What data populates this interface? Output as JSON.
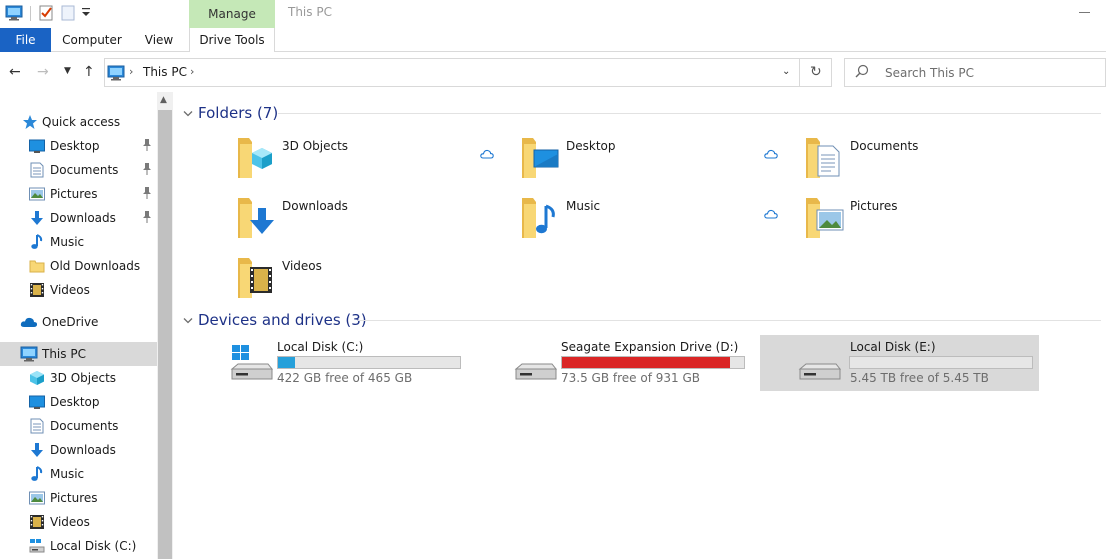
{
  "window": {
    "title": "This PC"
  },
  "ribbon": {
    "contextual_group": "Manage",
    "tabs": [
      {
        "label": "File"
      },
      {
        "label": "Computer"
      },
      {
        "label": "View"
      },
      {
        "label": "Drive Tools"
      }
    ]
  },
  "address": {
    "path": [
      "This PC"
    ],
    "search_placeholder": "Search This PC"
  },
  "sidebar": {
    "items": [
      {
        "label": "Quick access",
        "icon": "star-icon"
      },
      {
        "label": "Desktop",
        "icon": "desktop-icon",
        "pinned": true
      },
      {
        "label": "Documents",
        "icon": "documents-icon",
        "pinned": true
      },
      {
        "label": "Pictures",
        "icon": "pictures-icon",
        "pinned": true
      },
      {
        "label": "Downloads",
        "icon": "downloads-icon",
        "pinned": true
      },
      {
        "label": "Music",
        "icon": "music-icon"
      },
      {
        "label": "Old Downloads",
        "icon": "folder-icon"
      },
      {
        "label": "Videos",
        "icon": "videos-icon"
      },
      {
        "label": "OneDrive",
        "icon": "onedrive-cloud-icon"
      },
      {
        "label": "This PC",
        "icon": "computer-icon",
        "selected": true
      },
      {
        "label": "3D Objects",
        "icon": "3d-objects-icon"
      },
      {
        "label": "Desktop",
        "icon": "desktop-icon"
      },
      {
        "label": "Documents",
        "icon": "documents-icon"
      },
      {
        "label": "Downloads",
        "icon": "downloads-icon"
      },
      {
        "label": "Music",
        "icon": "music-icon"
      },
      {
        "label": "Pictures",
        "icon": "pictures-icon"
      },
      {
        "label": "Videos",
        "icon": "videos-icon"
      },
      {
        "label": "Local Disk (C:)",
        "icon": "windows-drive-icon"
      }
    ]
  },
  "folders": {
    "header": "Folders (7)",
    "items": [
      {
        "label": "3D Objects",
        "icon": "3d-objects-folder-icon",
        "cloud": true
      },
      {
        "label": "Desktop",
        "icon": "desktop-folder-icon",
        "cloud": true
      },
      {
        "label": "Documents",
        "icon": "documents-folder-icon",
        "cloud": false
      },
      {
        "label": "Downloads",
        "icon": "downloads-folder-icon",
        "cloud": false
      },
      {
        "label": "Music",
        "icon": "music-folder-icon",
        "cloud": true
      },
      {
        "label": "Pictures",
        "icon": "pictures-folder-icon",
        "cloud": false
      },
      {
        "label": "Videos",
        "icon": "videos-folder-icon",
        "cloud": false
      }
    ]
  },
  "drives": {
    "header": "Devices and drives (3)",
    "items": [
      {
        "label": "Local Disk (C:)",
        "free_text": "422 GB free of 465 GB",
        "used_fraction": 0.0925,
        "bar_color": "#26a0da",
        "icon": "windows-drive-icon",
        "selected": false
      },
      {
        "label": "Seagate Expansion Drive (D:)",
        "free_text": "73.5 GB free of 931 GB",
        "used_fraction": 0.921,
        "bar_color": "#da2626",
        "icon": "hard-drive-icon",
        "selected": false
      },
      {
        "label": "Local Disk (E:)",
        "free_text": "5.45 TB free of 5.45 TB",
        "used_fraction": 0.0,
        "bar_color": "#26a0da",
        "icon": "hard-drive-icon",
        "selected": true
      }
    ]
  },
  "colors": {
    "accent": "#1a63c4",
    "manage_tab": "#c5e8b7",
    "group_header": "#1e3287",
    "selection": "#d9d9d9"
  }
}
